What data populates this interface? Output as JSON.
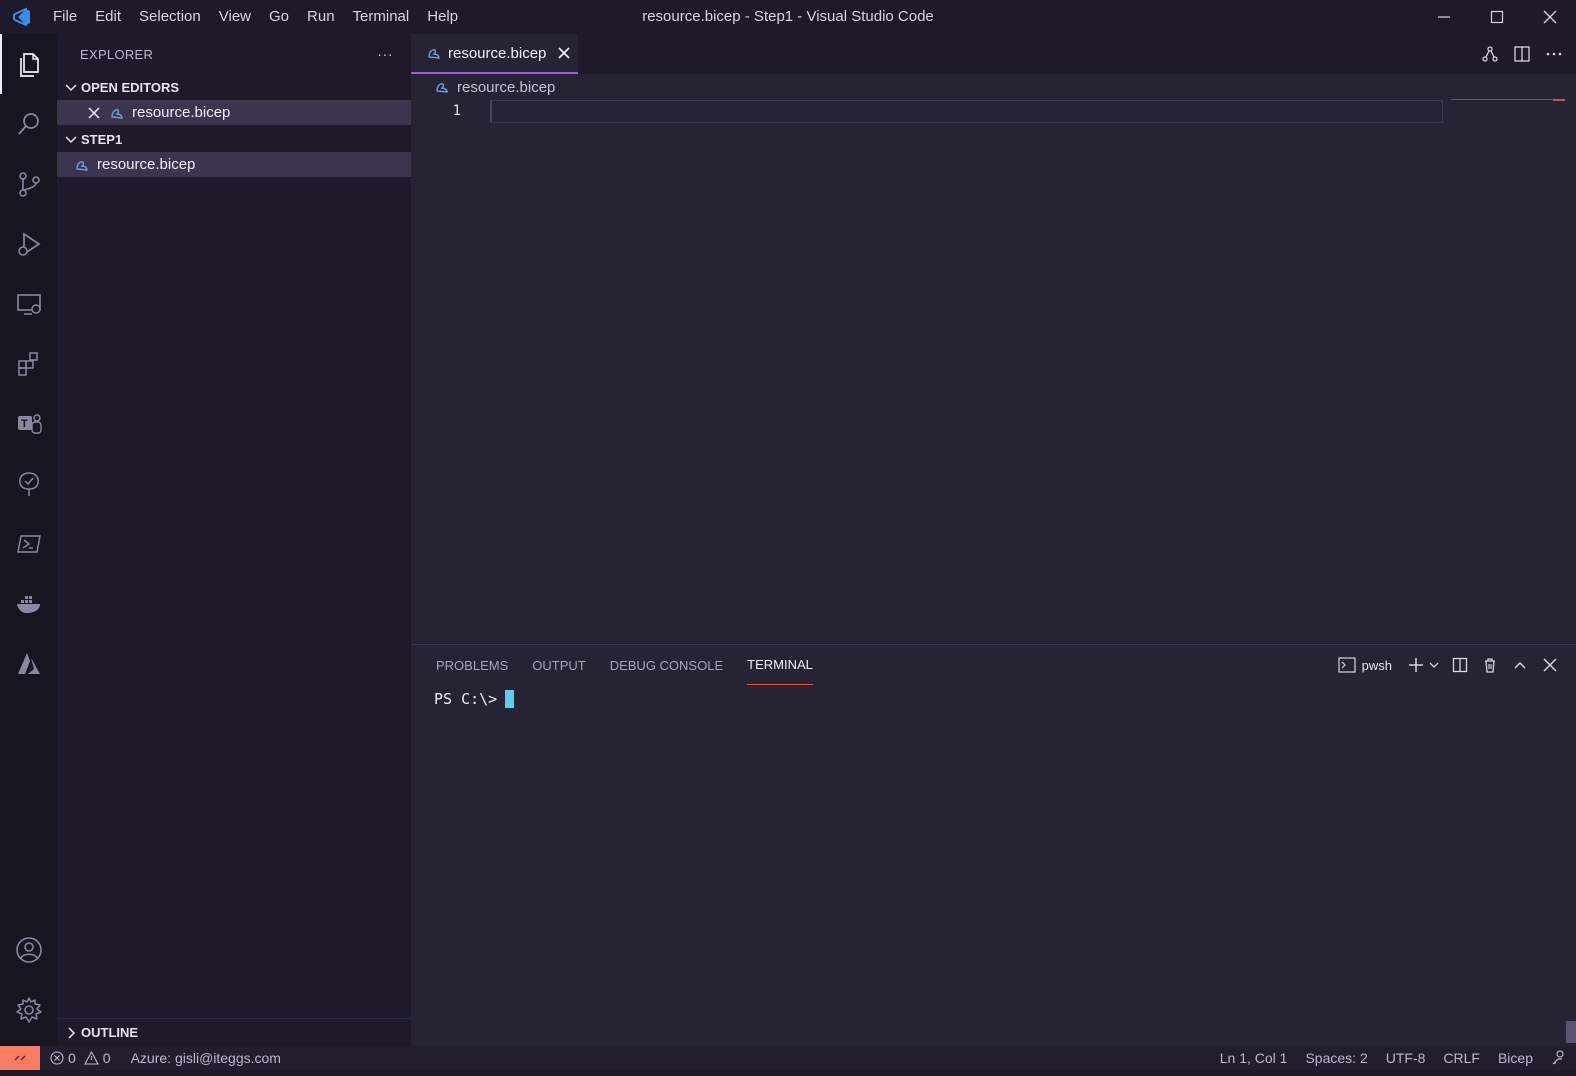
{
  "window": {
    "title": "resource.bicep - Step1 - Visual Studio Code",
    "menu": [
      "File",
      "Edit",
      "Selection",
      "View",
      "Go",
      "Run",
      "Terminal",
      "Help"
    ]
  },
  "sidebar": {
    "header": "EXPLORER",
    "more": "···",
    "open_editors_label": "OPEN EDITORS",
    "open_editors": [
      {
        "name": "resource.bicep"
      }
    ],
    "folder_label": "STEP1",
    "files": [
      {
        "name": "resource.bicep"
      }
    ],
    "outline_label": "OUTLINE"
  },
  "editor": {
    "tab_label": "resource.bicep",
    "breadcrumb": "resource.bicep",
    "line_numbers": [
      "1"
    ]
  },
  "panel": {
    "tabs": [
      "PROBLEMS",
      "OUTPUT",
      "DEBUG CONSOLE",
      "TERMINAL"
    ],
    "active_tab": "TERMINAL",
    "terminal_name": "pwsh",
    "prompt": "PS C:\\>"
  },
  "statusbar": {
    "errors": "0",
    "warnings": "0",
    "account": "Azure: gisli@iteggs.com",
    "position": "Ln 1, Col 1",
    "spaces": "Spaces: 2",
    "encoding": "UTF-8",
    "eol": "CRLF",
    "language": "Bicep"
  },
  "colors": {
    "accent_tab": "#a25ad8",
    "terminal_tab_underline": "#e8503a",
    "remote_button": "#f87d62",
    "cursor": "#5bd0ee"
  }
}
